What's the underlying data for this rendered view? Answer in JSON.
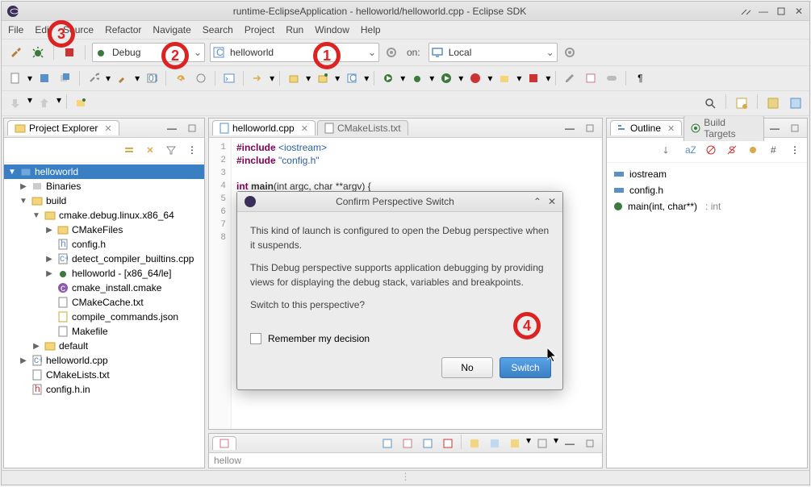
{
  "window_title": "runtime-EclipseApplication - helloworld/helloworld.cpp - Eclipse SDK",
  "menu": [
    "File",
    "Edit",
    "Source",
    "Refactor",
    "Navigate",
    "Search",
    "Project",
    "Run",
    "Window",
    "Help"
  ],
  "launch_toolbar": {
    "mode": "Debug",
    "config": "helloworld",
    "on_label": "on:",
    "target": "Local"
  },
  "project_explorer": {
    "title": "Project Explorer",
    "tree": {
      "root": "helloworld",
      "items": [
        {
          "label": "Binaries",
          "kind": "bin"
        },
        {
          "label": "build",
          "kind": "folder",
          "children": [
            {
              "label": "cmake.debug.linux.x86_64",
              "kind": "folder",
              "children": [
                {
                  "label": "CMakeFiles",
                  "kind": "folder"
                },
                {
                  "label": "config.h",
                  "kind": "h"
                },
                {
                  "label": "detect_compiler_builtins.cpp",
                  "kind": "cpp"
                },
                {
                  "label": "helloworld - [x86_64/le]",
                  "kind": "exe"
                },
                {
                  "label": "cmake_install.cmake",
                  "kind": "cmake"
                },
                {
                  "label": "CMakeCache.txt",
                  "kind": "txt"
                },
                {
                  "label": "compile_commands.json",
                  "kind": "json"
                },
                {
                  "label": "Makefile",
                  "kind": "txt"
                }
              ]
            },
            {
              "label": "default",
              "kind": "folder"
            }
          ]
        },
        {
          "label": "helloworld.cpp",
          "kind": "cpp"
        },
        {
          "label": "CMakeLists.txt",
          "kind": "txt"
        },
        {
          "label": "config.h.in",
          "kind": "h"
        }
      ]
    }
  },
  "editor": {
    "tabs": [
      "helloworld.cpp",
      "CMakeLists.txt"
    ],
    "lines": [
      1,
      2,
      3,
      4,
      5,
      6,
      7,
      8
    ],
    "code": {
      "l1_keyword": "#include ",
      "l1_inc": "<iostream>",
      "l2_keyword": "#include ",
      "l2_inc": "\"config.h\"",
      "l4_part1": "int ",
      "l4_part2": "main",
      "l4_part3": "(int argc, char **argv) {"
    }
  },
  "outline": {
    "title": "Outline",
    "build_targets_title": "Build Targets",
    "items": [
      {
        "label": "iostream",
        "kind": "inc"
      },
      {
        "label": "config.h",
        "kind": "inc"
      },
      {
        "label": "main(int, char**)",
        "kind": "fn",
        "ret": ": int"
      }
    ]
  },
  "bottom_tab_text": "hellow",
  "dialog": {
    "title": "Confirm Perspective Switch",
    "p1": "This kind of launch is configured to open the Debug perspective when it suspends.",
    "p2": "This Debug perspective supports application debugging by providing views for displaying the debug stack, variables and breakpoints.",
    "p3": "Switch to this perspective?",
    "remember": "Remember my decision",
    "no_btn": "No",
    "switch_btn": "Switch"
  },
  "callouts": {
    "c1": "1",
    "c2": "2",
    "c3": "3",
    "c4": "4"
  }
}
